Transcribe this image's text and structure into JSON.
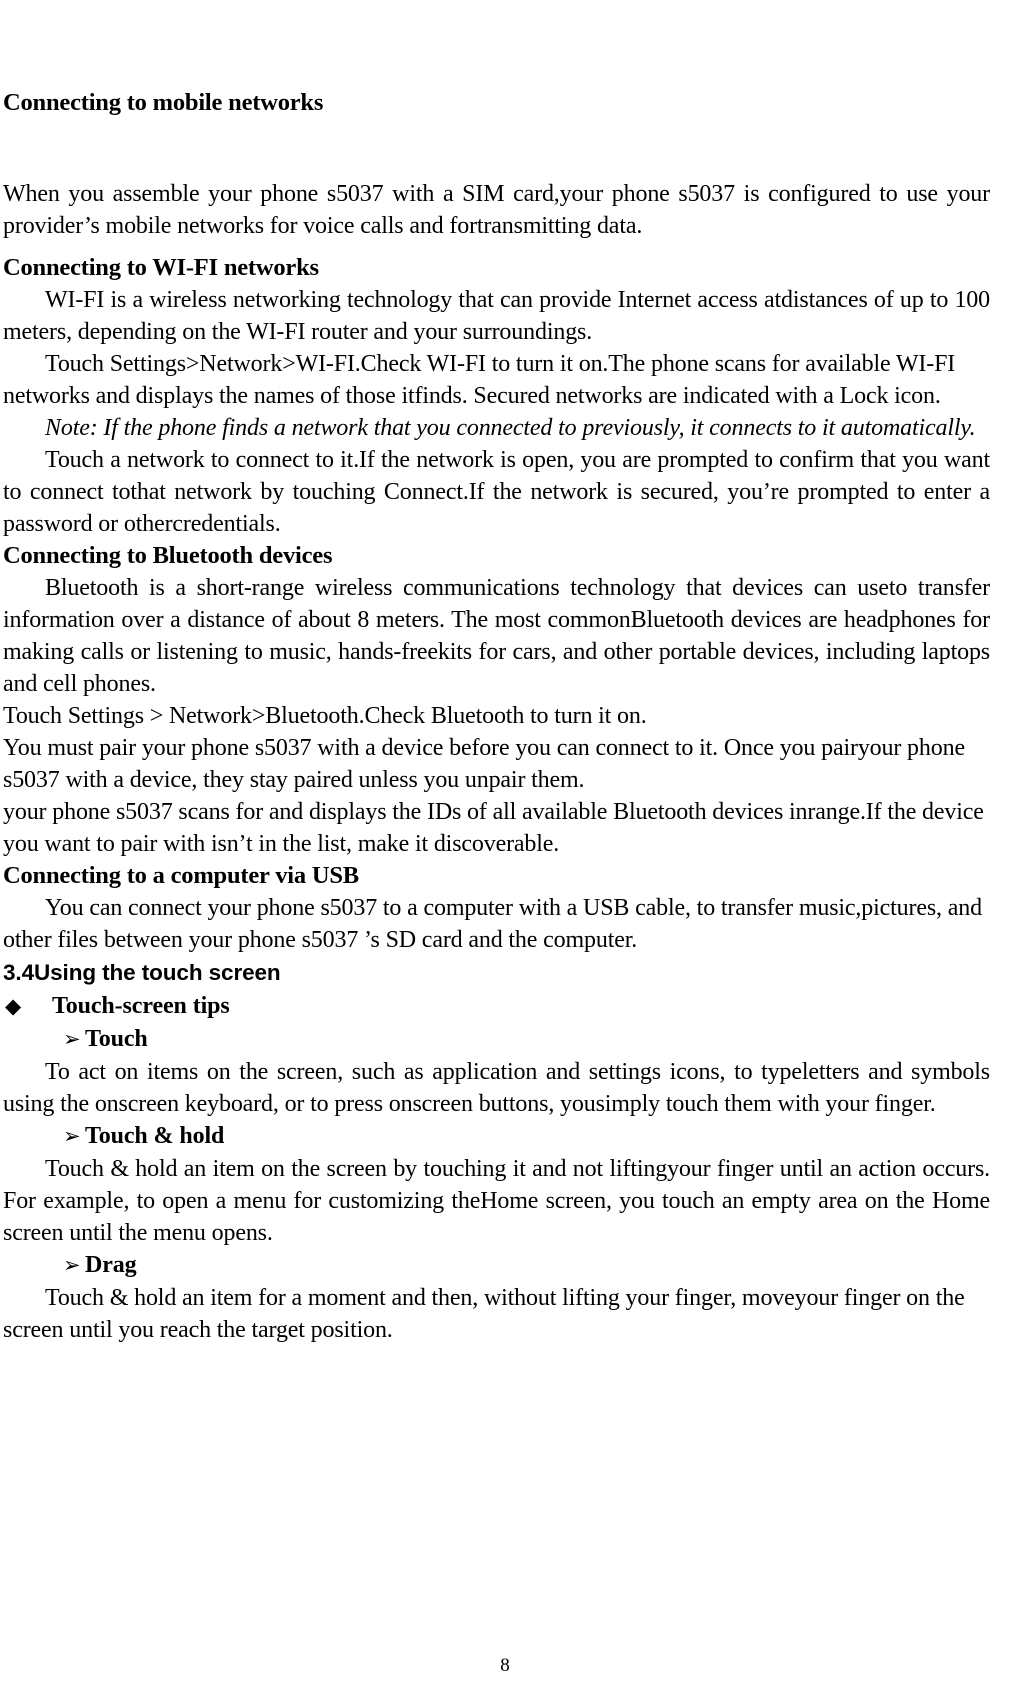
{
  "document": {
    "page_number": "8"
  },
  "sections": {
    "mobile_networks": {
      "heading": "Connecting to mobile networks",
      "paragraph": "When you assemble your phone s5037   with a SIM card,your phone s5037   is configured to use your provider’s mobile networks for voice calls and fortransmitting data."
    },
    "wifi": {
      "heading": "Connecting to WI-FI networks",
      "p1": "WI-FI is a wireless networking technology that can provide Internet access atdistances of up to 100 meters, depending on the WI-FI router and your surroundings.",
      "p2": "Touch Settings>Network>WI-FI.Check WI-FI to turn it on.The phone scans for available WI-FI networks and displays the names of those itfinds. Secured networks are indicated with a Lock icon.",
      "note": "Note: If the phone finds a network that you connected to previously, it connects to it automatically.",
      "p3": "Touch a network to connect to it.If the network is open, you are prompted to confirm that you want to connect tothat network by touching Connect.If the network is secured, you’re prompted to enter a password or othercredentials."
    },
    "bluetooth": {
      "heading": "Connecting to Bluetooth devices",
      "p1": "Bluetooth is a short-range wireless communications technology that devices can useto transfer information over a distance of about 8 meters. The most commonBluetooth devices are headphones for making calls or listening to music, hands-freekits for cars, and other portable devices, including laptops and cell phones.",
      "p2": "Touch Settings > Network>Bluetooth.Check Bluetooth to turn it on.",
      "p3": "You must pair your phone s5037   with a device before you can connect to it. Once you pairyour phone s5037   with a device, they stay paired unless you unpair them.",
      "p4": "your phone s5037   scans for and displays the IDs of all available Bluetooth devices inrange.If the device you want to pair with isn’t in the list, make it discoverable."
    },
    "usb": {
      "heading": "Connecting to a computer via USB",
      "p1": "You can connect your phone s5037   to a computer with a USB cable, to transfer music,pictures, and other files between your phone s5037 ’s SD card and the computer."
    },
    "touch_screen": {
      "heading": "3.4Using the touch screen",
      "bullet_tips": {
        "glyph": "◆",
        "glyph_name": "diamond-bullet-icon",
        "label": "Touch-screen tips"
      },
      "items": [
        {
          "glyph": "➢",
          "glyph_name": "arrow-bullet-icon",
          "label": "Touch",
          "body": "To act on items on the screen, such as application and settings icons, to typeletters and symbols using the onscreen keyboard, or to press onscreen buttons, yousimply touch them with your finger."
        },
        {
          "glyph": "➢",
          "glyph_name": "arrow-bullet-icon",
          "label": "Touch & hold",
          "body": "Touch & hold an item on the screen by touching it and not liftingyour finger until an action occurs. For example, to open a menu for customizing theHome screen, you touch an empty area on the Home screen until the menu opens."
        },
        {
          "glyph": "➢",
          "glyph_name": "arrow-bullet-icon",
          "label": "Drag",
          "body": "Touch & hold an item for a moment and then, without lifting your finger, moveyour finger on the screen until you reach the target position."
        }
      ]
    }
  }
}
